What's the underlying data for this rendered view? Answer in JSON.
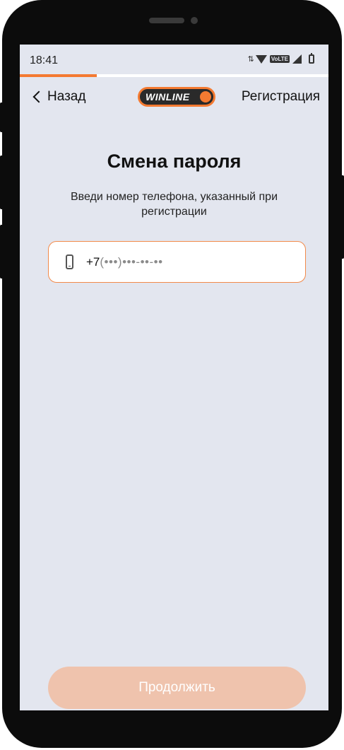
{
  "status_bar": {
    "time": "18:41",
    "volte_label": "VoLTE",
    "data_arrows": "⇅"
  },
  "progress": {
    "value": 0.25,
    "color": "#f47a31"
  },
  "nav": {
    "back_label": "Назад",
    "logo_text": "WINLINE",
    "register_label": "Регистрация"
  },
  "main": {
    "title": "Смена пароля",
    "subtitle": "Введи номер телефона, указанный при регистрации",
    "phone_prefix": "+7",
    "phone_mask": "(•••)•••-••-••"
  },
  "footer": {
    "continue_label": "Продолжить"
  },
  "colors": {
    "accent": "#f47a31",
    "button_disabled": "#efc3ad",
    "screen_bg": "#e3e6ef"
  }
}
